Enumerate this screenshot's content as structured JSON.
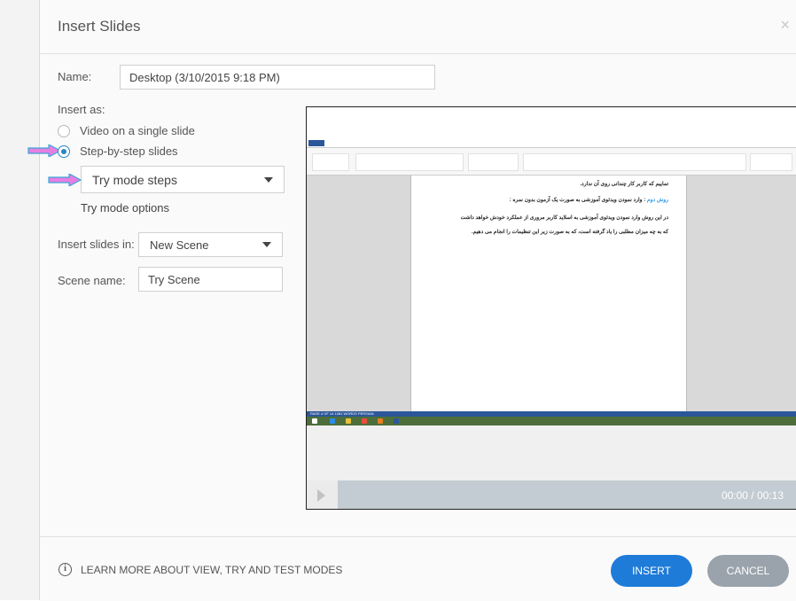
{
  "dialog": {
    "title": "Insert Slides",
    "close_glyph": "×"
  },
  "form": {
    "name_label": "Name:",
    "name_value": "Desktop (3/10/2015 9:18 PM)",
    "insert_as_label": "Insert as:",
    "option_video": "Video on a single slide",
    "option_steps": "Step-by-step slides",
    "selected_option": "Step-by-step slides",
    "mode_select_value": "Try mode steps",
    "mode_options_link": "Try mode options",
    "insert_in_label": "Insert slides in:",
    "insert_in_value": "New Scene",
    "scene_name_label": "Scene name:",
    "scene_name_value": "Try Scene"
  },
  "preview": {
    "doc_lines": [
      "تماییم که کاربر کار چندانی روی آن ندارد.",
      "روش دوم : وارد نمودن ویدئوی آموزشی به صورت یک آزمون بدون نمره :",
      "در این روش وارد نمودن ویدئوی آموزشی به اسلاید کاربر مروری از عملکرد خودش خواهد داشت",
      "که به چه میزان مطلبی را یاد گرفته است، که به صورت زیر این تنظیمات را انجام می دهیم."
    ],
    "doc_highlight": "روش دوم",
    "status_text": "PAGE 4 OF 14   1081 WORDS   PERSIAN",
    "timecode": "00:00 / 00:13"
  },
  "footer": {
    "info_icon": "info-icon",
    "learn_more": "LEARN MORE ABOUT VIEW, TRY AND TEST MODES",
    "insert_button": "INSERT",
    "cancel_button": "CANCEL"
  },
  "colors": {
    "accent": "#1f7bd8",
    "cancel": "#9aa3ab",
    "arrow": "#e67fe2",
    "arrow_outline": "#3aa8d8"
  },
  "icons": [
    "info-icon",
    "close-icon",
    "radio-button",
    "chevron-down-icon",
    "play-icon",
    "pointer-arrow-icon"
  ]
}
